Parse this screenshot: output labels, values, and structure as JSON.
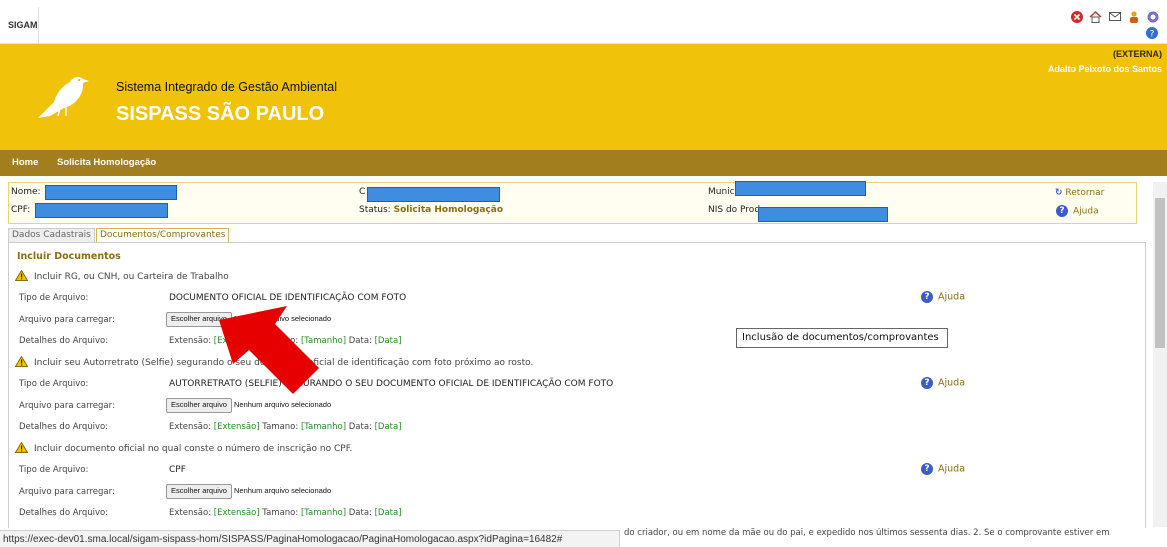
{
  "app": {
    "short_name": "SIGAM"
  },
  "header": {
    "subtitle": "Sistema Integrado de Gestão Ambiental",
    "title": "SISPASS SÃO PAULO",
    "user_type": "(EXTERNA)",
    "user_name": "Adalto Peixoto dos Santos",
    "icons": [
      "close-icon",
      "home-icon",
      "mail-icon",
      "user-icon",
      "help-icon",
      "refresh-icon"
    ]
  },
  "nav": {
    "home": "Home",
    "current": "Solicita Homologação"
  },
  "info": {
    "nome_label": "Nome:",
    "cpf_label": "CPF:",
    "c_label": "C",
    "status_label": "Status:",
    "status_value": "Solicita Homologação",
    "municipio_label": "Municí",
    "nis_label": "NIS do Prod",
    "retornar": "Retornar",
    "ajuda": "Ajuda"
  },
  "tabs": [
    "Dados Cadastrais",
    "Documentos/Comprovantes"
  ],
  "panel": {
    "title": "Incluir Documentos",
    "labels": {
      "tipo": "Tipo de Arquivo:",
      "arquivo": "Arquivo para carregar:",
      "detalhes": "Detalhes do Arquivo:",
      "extensao": "Extensão:",
      "extensao_val": "[Extensão]",
      "tamanho": "Tamano:",
      "tamanho_val": "[Tamanho]",
      "data": "Data:",
      "data_val": "[Data]",
      "file_button": "Escolher arquivo",
      "no_file": "Nenhum arquivo selecionado",
      "help": "Ajuda"
    },
    "docs": [
      {
        "instruction": "Incluir RG, ou CNH, ou Carteira de Trabalho",
        "tipo": "DOCUMENTO OFICIAL DE IDENTIFICAÇÃO COM FOTO"
      },
      {
        "instruction": "Incluir seu Autorretrato (Selfie) segurando o seu documento oficial de identificação com foto próximo ao rosto.",
        "tipo": "AUTORRETRATO (SELFIE) SEGURANDO O SEU DOCUMENTO OFICIAL DE IDENTIFICAÇÃO COM FOTO"
      },
      {
        "instruction": "Incluir documento oficial no qual conste o número de inscrição no CPF.",
        "tipo": "CPF"
      }
    ],
    "tooltip": "Inclusão de documentos/comprovantes"
  },
  "statusbar": {
    "url": "https://exec-dev01.sma.local/sigam-sispass-hom/SISPASS/PaginaHomologacao/PaginaHomologacao.aspx?idPagina=16482#",
    "overflow_text": "do criador, ou em nome da mãe ou do pai, e expedido nos últimos sessenta dias. 2. Se o comprovante estiver em"
  },
  "colors": {
    "banner": "#f0c20a",
    "nav": "#a37e1e",
    "accent": "#8a6d12",
    "link_green": "#2a8a2a",
    "annotation_arrow": "#e60000"
  }
}
